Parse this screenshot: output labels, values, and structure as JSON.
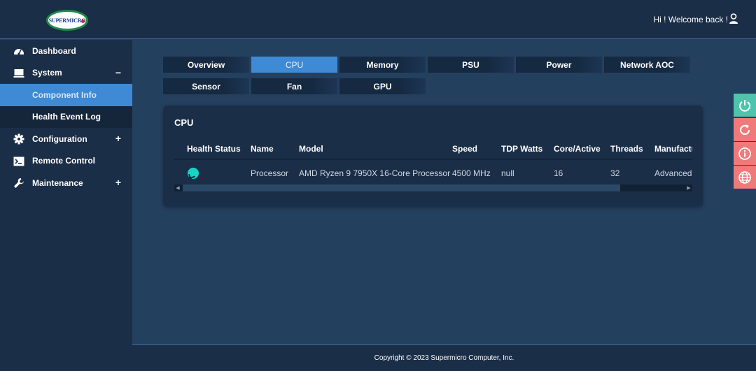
{
  "header": {
    "logo_text": "SUPERMICRO",
    "welcome": "Hi ! Welcome back !"
  },
  "sidebar": {
    "items": [
      {
        "label": "Dashboard",
        "icon": "dashboard-icon"
      },
      {
        "label": "System",
        "icon": "monitor-icon",
        "toggle": "−"
      },
      {
        "label": "Component Info",
        "sub": true,
        "active": true
      },
      {
        "label": "Health Event Log",
        "sub": true
      },
      {
        "label": "Configuration",
        "icon": "gear-icon",
        "toggle": "+"
      },
      {
        "label": "Remote Control",
        "icon": "terminal-icon"
      },
      {
        "label": "Maintenance",
        "icon": "wrench-icon",
        "toggle": "+"
      }
    ]
  },
  "tabs": [
    "Overview",
    "CPU",
    "Memory",
    "PSU",
    "Power",
    "Network AOC",
    "Sensor",
    "Fan",
    "GPU"
  ],
  "active_tab": "CPU",
  "card": {
    "title": "CPU",
    "columns": [
      "Health Status",
      "Name",
      "Model",
      "Speed",
      "TDP Watts",
      "Core/Active",
      "Threads",
      "Manufactu"
    ],
    "rows": [
      {
        "health": "ok",
        "name": "Processor",
        "model": "AMD Ryzen 9 7950X 16-Core Processor",
        "speed": "4500 MHz",
        "tdp": "null",
        "cores": "16",
        "threads": "32",
        "manufacturer": "Advanced M"
      }
    ]
  },
  "side_buttons": [
    {
      "name": "power",
      "icon": "power-icon",
      "color": "#4fc3ad"
    },
    {
      "name": "refresh",
      "icon": "refresh-icon",
      "color": "#f07a7a"
    },
    {
      "name": "info",
      "icon": "info-icon",
      "color": "#f07a7a"
    },
    {
      "name": "globe",
      "icon": "globe-icon",
      "color": "#f07a7a"
    }
  ],
  "footer": {
    "copyright": "Copyright © 2023 Supermicro Computer, Inc."
  },
  "colors": {
    "accent": "#3e8ad4",
    "health_ok": "#19d3c5",
    "panel": "#1b2e47",
    "background": "#24405f"
  }
}
